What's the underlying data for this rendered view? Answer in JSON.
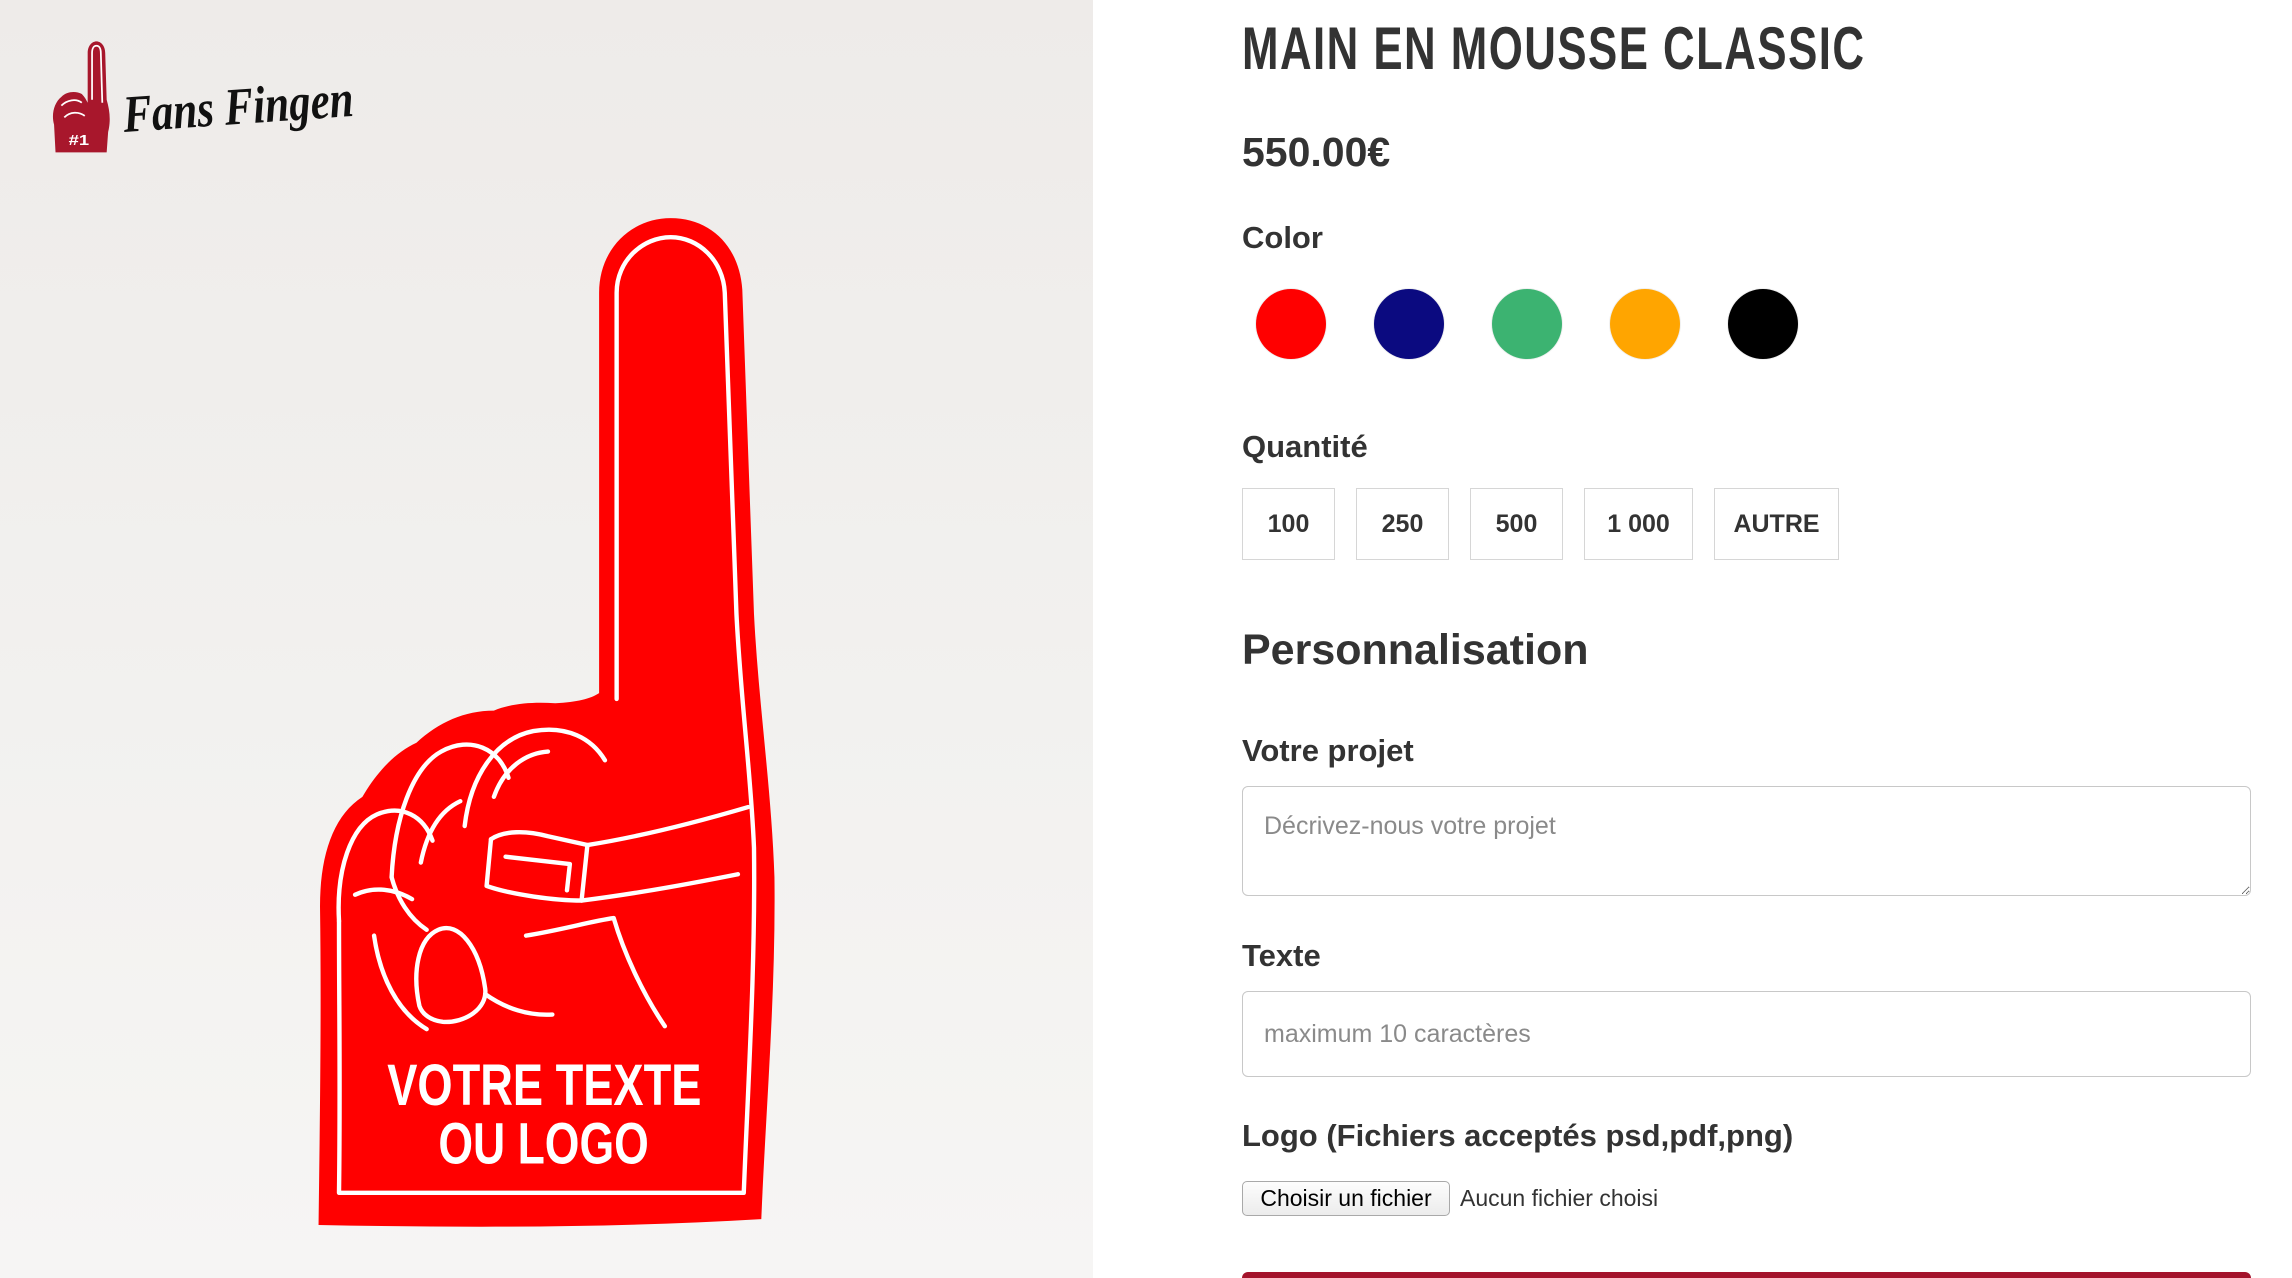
{
  "logo": {
    "text": "Fans Fingen",
    "badge": "#1",
    "color": "#a8172c"
  },
  "product_image": {
    "print_line_1": "VOTRE TEXTE",
    "print_line_2": "OU LOGO",
    "foam_color": "#ff0000"
  },
  "product": {
    "title": "MAIN EN MOUSSE CLASSIC",
    "price": "550.00€"
  },
  "color": {
    "label": "Color",
    "swatches": [
      "#ff0000",
      "#0b0a80",
      "#3cb371",
      "#ffa500",
      "#000000"
    ]
  },
  "quantity": {
    "label": "Quantité",
    "options": [
      "100",
      "250",
      "500",
      "1 000",
      "AUTRE"
    ]
  },
  "personalization": {
    "heading": "Personnalisation",
    "project": {
      "label": "Votre projet",
      "placeholder": "Décrivez-nous votre projet"
    },
    "text": {
      "label": "Texte",
      "placeholder": "maximum 10 caractères"
    },
    "logo": {
      "label": "Logo (Fichiers acceptés psd,pdf,png)",
      "button": "Choisir un fichier",
      "status": "Aucun fichier choisi"
    }
  },
  "theme": {
    "text": "#333333",
    "accent": "#a4132b"
  }
}
